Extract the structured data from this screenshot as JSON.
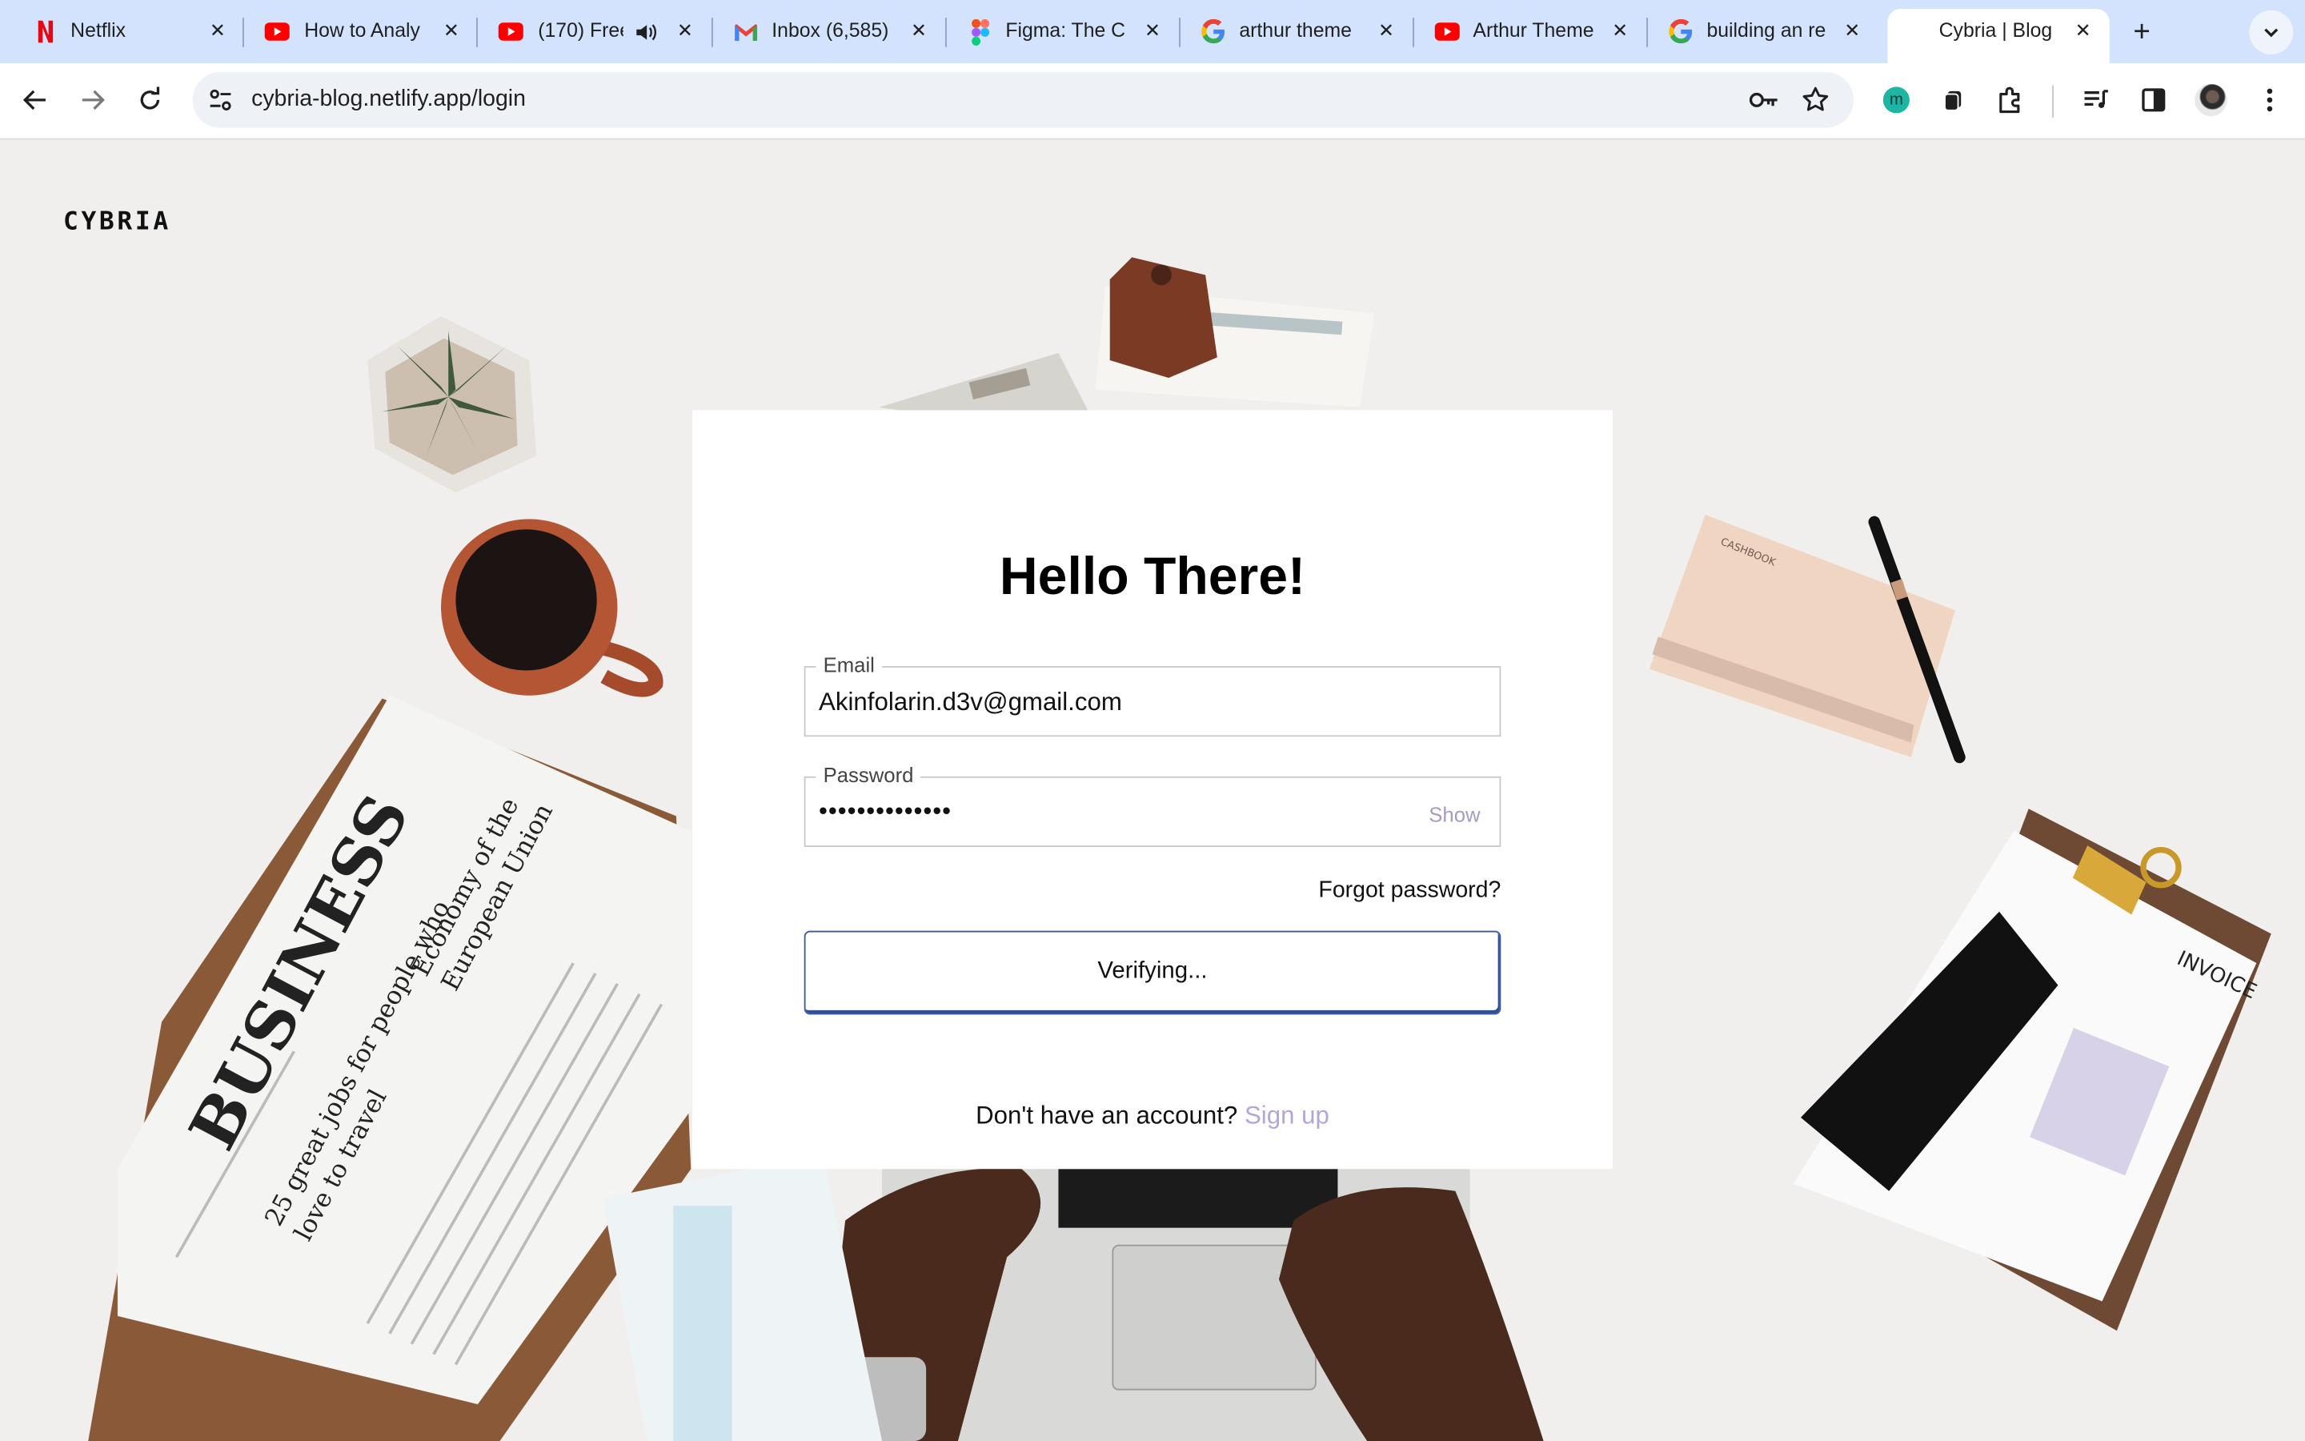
{
  "browser": {
    "tabs": [
      {
        "title": "Netflix",
        "icon": "netflix-icon"
      },
      {
        "title": "How to Analy",
        "icon": "youtube-icon"
      },
      {
        "title": "(170) Free",
        "icon": "youtube-icon",
        "audio": true
      },
      {
        "title": "Inbox (6,585)",
        "icon": "gmail-icon"
      },
      {
        "title": "Figma: The C",
        "icon": "figma-icon"
      },
      {
        "title": "arthur theme",
        "icon": "google-icon"
      },
      {
        "title": "Arthur Theme",
        "icon": "youtube-icon"
      },
      {
        "title": "building an re",
        "icon": "google-icon"
      },
      {
        "title": "Cybria | Blog",
        "icon": "none",
        "active": true
      }
    ],
    "new_tab": "+",
    "url": "cybria-blog.netlify.app/login",
    "profile_initial": "m"
  },
  "page": {
    "logo": "CYBRIA",
    "heading": "Hello There!",
    "email": {
      "label": "Email",
      "value": "Akinfolarin.d3v@gmail.com"
    },
    "password": {
      "label": "Password",
      "masked": "••••••••••••••",
      "toggle": "Show"
    },
    "forgot": "Forgot password?",
    "submit": "Verifying...",
    "signup_prompt": "Don't have an account?",
    "signup_link": "Sign up"
  },
  "colors": {
    "tabstrip": "#d3e3fd",
    "accent_link": "#b5a6d6",
    "button_border": "#3a5aa0"
  }
}
